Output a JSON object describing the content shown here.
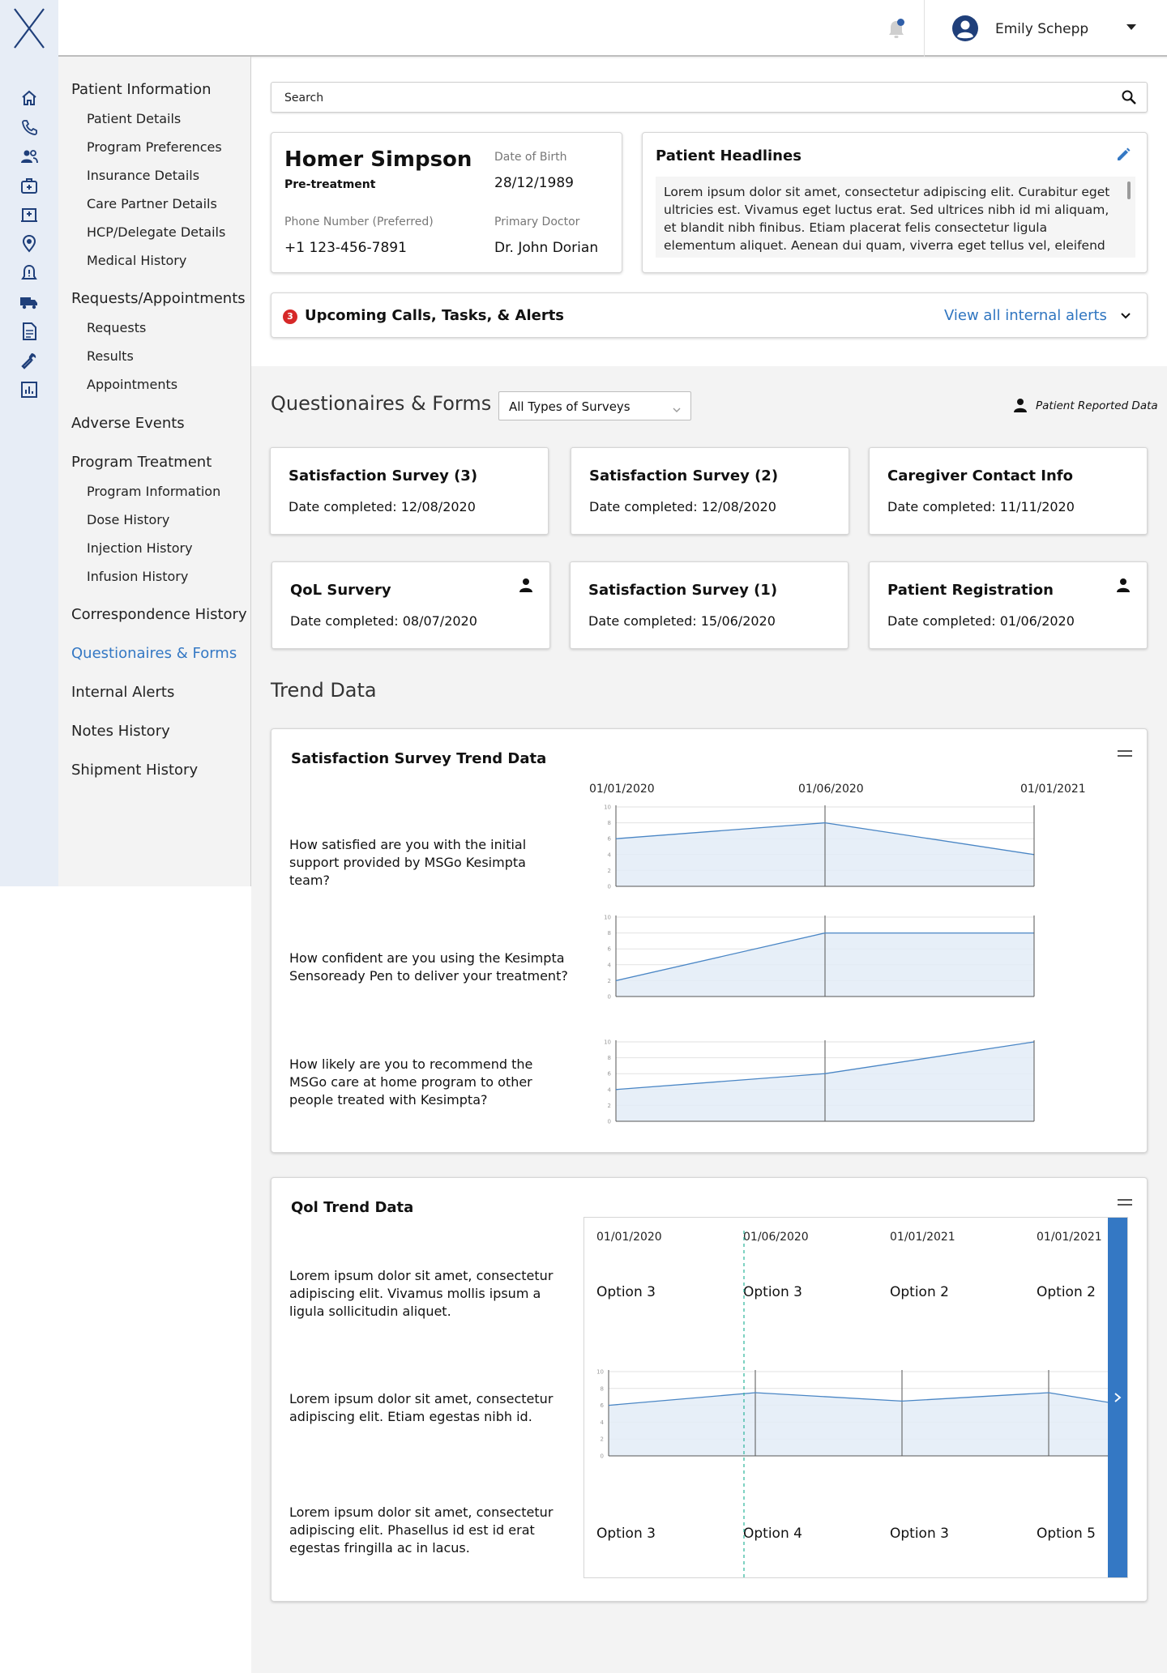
{
  "header": {
    "logo": "X",
    "user_name": "Emily Schepp"
  },
  "rail_icons": [
    "home-icon",
    "phone-icon",
    "people-icon",
    "medical-kit-icon",
    "hospital-icon",
    "location-pin-icon",
    "alert-bell-icon",
    "truck-icon",
    "document-icon",
    "wrench-icon",
    "report-chart-icon"
  ],
  "subnav": {
    "patient_information": "Patient Information",
    "patient_details": "Patient Details",
    "program_preferences": "Program Preferences",
    "insurance_details": "Insurance Details",
    "care_partner_details": "Care Partner Details",
    "hcp_delegate_details": "HCP/Delegate Details",
    "medical_history": "Medical History",
    "requests_appointments": "Requests/Appointments",
    "requests": "Requests",
    "results": "Results",
    "appointments": "Appointments",
    "adverse_events": "Adverse Events",
    "program_treatment": "Program Treatment",
    "program_information": "Program Information",
    "dose_history": "Dose History",
    "injection_history": "Injection History",
    "infusion_history": "Infusion History",
    "correspondence_history": "Correspondence History",
    "questionnaires_forms": "Questionaires & Forms",
    "internal_alerts": "Internal Alerts",
    "notes_history": "Notes History",
    "shipment_history": "Shipment History"
  },
  "search": {
    "label": "Search"
  },
  "patient": {
    "name": "Homer Simpson",
    "status": "Pre-treatment",
    "dob_label": "Date of Birth",
    "dob": "28/12/1989",
    "phone_label": "Phone Number (Preferred)",
    "phone": "+1 123-456-7891",
    "doctor_label": "Primary Doctor",
    "doctor": "Dr. John Dorian"
  },
  "headlines": {
    "title": "Patient Headlines",
    "text": "Lorem ipsum dolor sit amet, consectetur adipiscing elit. Curabitur eget ultricies est. Vivamus eget luctus erat. Sed ultrices nibh id mi aliquam, et blandit nibh finibus. Etiam placerat felis consectetur ligula elementum aliquet. Aenean dui quam, viverra eget tellus vel, eleifend tincidunt nisi."
  },
  "alerts": {
    "count": "3",
    "title": "Upcoming Calls, Tasks, & Alerts",
    "link": "View all internal alerts"
  },
  "forms": {
    "title": "Questionaires & Forms",
    "filter": "All Types of Surveys",
    "legend": "Patient Reported Data",
    "cards": [
      {
        "title": "Satisfaction Survey (3)",
        "date": "Date completed: 12/08/2020"
      },
      {
        "title": "Satisfaction Survey (2)",
        "date": "Date completed: 12/08/2020"
      },
      {
        "title": "Caregiver Contact Info",
        "date": "Date completed: 11/11/2020"
      },
      {
        "title": "QoL Survery",
        "date": "Date completed: 08/07/2020"
      },
      {
        "title": "Satisfaction Survey (1)",
        "date": "Date completed: 15/06/2020"
      },
      {
        "title": "Patient Registration",
        "date": "Date completed: 01/06/2020"
      }
    ]
  },
  "trend": {
    "title": "Trend Data",
    "satisfaction": {
      "title": "Satisfaction Survey Trend Data",
      "dates": [
        "01/01/2020",
        "01/06/2020",
        "01/01/2021"
      ],
      "questions": [
        "How satisfied are you with the initial support provided by MSGo Kesimpta team?",
        "How confident are you using the Kesimpta Sensoready Pen to deliver your treatment?",
        "How likely are you to recommend the MSGo care at home program to other people treated with Kesimpta?"
      ]
    },
    "qol": {
      "title": "Qol Trend Data",
      "dates": [
        "01/01/2020",
        "01/06/2020",
        "01/01/2021",
        "01/01/2021"
      ],
      "questions": [
        "Lorem ipsum dolor sit amet, consectetur adipiscing elit. Vivamus mollis ipsum a ligula sollicitudin aliquet.",
        "Lorem ipsum dolor sit amet, consectetur adipiscing elit. Etiam egestas nibh id.",
        "Lorem ipsum dolor sit amet, consectetur adipiscing elit. Phasellus id est id erat egestas fringilla ac in lacus."
      ],
      "row1_options": [
        "Option 3",
        "Option 3",
        "Option 2",
        "Option 2"
      ],
      "row3_options": [
        "Option 3",
        "Option 4",
        "Option 3",
        "Option 5"
      ]
    }
  },
  "chart_data": [
    {
      "type": "area",
      "x": [
        "01/01/2020",
        "01/06/2020",
        "01/01/2021"
      ],
      "y": [
        6,
        8,
        4
      ],
      "ylim": [
        0,
        10
      ],
      "yticks": [
        "0",
        "2",
        "4",
        "6",
        "8",
        "10"
      ]
    },
    {
      "type": "area",
      "x": [
        "01/01/2020",
        "01/06/2020",
        "01/01/2021"
      ],
      "y": [
        2,
        8,
        8
      ],
      "ylim": [
        0,
        10
      ],
      "yticks": [
        "0",
        "2",
        "4",
        "6",
        "8",
        "10"
      ]
    },
    {
      "type": "area",
      "x": [
        "01/01/2020",
        "01/06/2020",
        "01/01/2021"
      ],
      "y": [
        4,
        6,
        10
      ],
      "ylim": [
        0,
        10
      ],
      "yticks": [
        "0",
        "2",
        "4",
        "6",
        "8",
        "10"
      ]
    },
    {
      "type": "area",
      "x": [
        "01/01/2020",
        "01/06/2020",
        "01/01/2021",
        "01/01/2021"
      ],
      "y": [
        6,
        7.5,
        6.5,
        7.5
      ],
      "ylim": [
        0,
        10
      ],
      "yticks": [
        "0",
        "2",
        "4",
        "6",
        "8",
        "10"
      ]
    }
  ],
  "colors": {
    "accent": "#3478c4",
    "rail_bg": "#e7edf6",
    "alert_badge": "#d62828",
    "chart_line": "#4a86c5",
    "chart_fill": "#e3ecf7"
  }
}
